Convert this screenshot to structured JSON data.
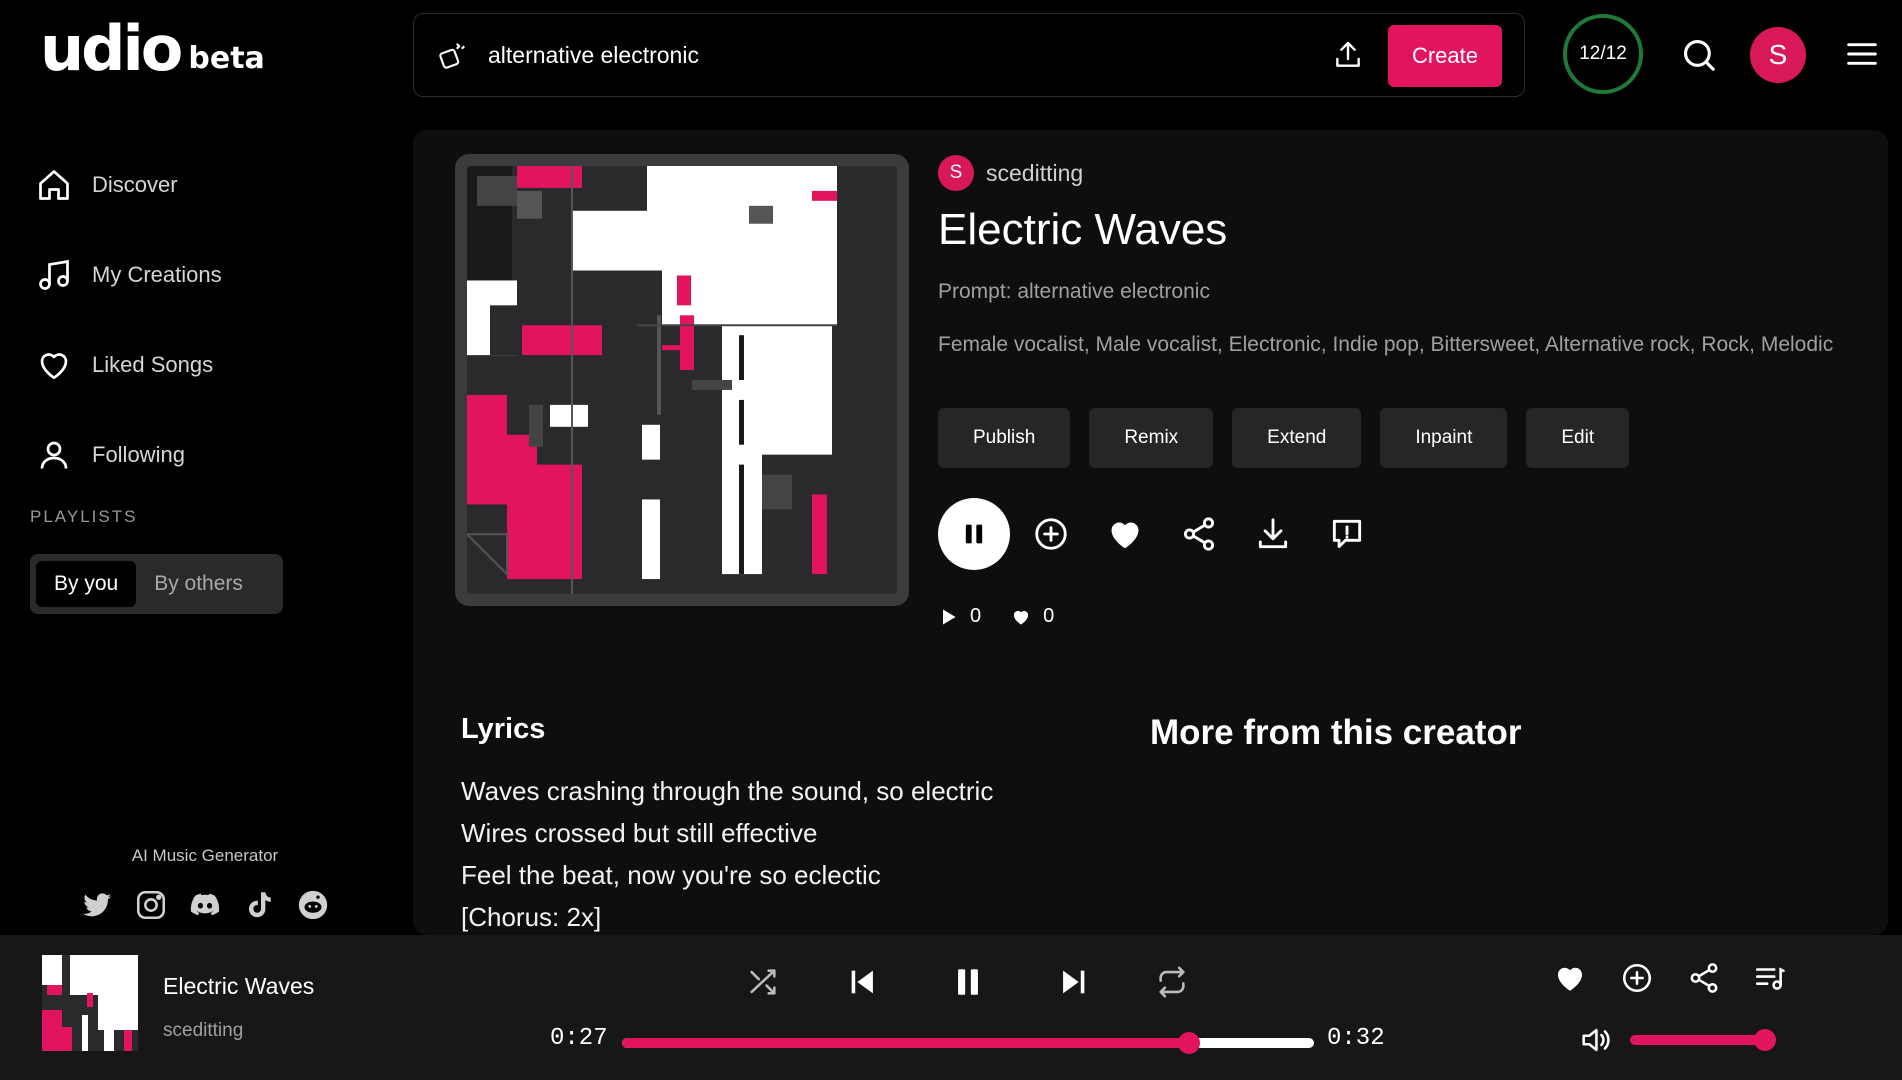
{
  "brand": {
    "word": "udio",
    "beta": "beta"
  },
  "nav": [
    {
      "label": "Discover",
      "icon": "home-icon"
    },
    {
      "label": "My Creations",
      "icon": "music-note-icon"
    },
    {
      "label": "Liked Songs",
      "icon": "heart-icon"
    },
    {
      "label": "Following",
      "icon": "person-icon"
    }
  ],
  "playlists": {
    "label": "PLAYLISTS",
    "tabs": [
      "By you",
      "By others"
    ],
    "active": "By you"
  },
  "footer": {
    "label": "AI Music Generator",
    "socials": [
      "twitter-icon",
      "instagram-icon",
      "discord-icon",
      "tiktok-icon",
      "reddit-icon"
    ]
  },
  "search": {
    "value": "alternative electronic",
    "create_label": "Create"
  },
  "credits": "12/12",
  "user": {
    "initial": "S"
  },
  "song": {
    "creator": "sceditting",
    "creator_initial": "S",
    "title": "Electric Waves",
    "prompt": "Prompt: alternative electronic",
    "tags": "Female vocalist, Male vocalist, Electronic, Indie pop, Bittersweet, Alternative rock, Rock, Melodic",
    "actions": [
      "Publish",
      "Remix",
      "Extend",
      "Inpaint",
      "Edit"
    ],
    "plays": "0",
    "likes": "0"
  },
  "lyrics": {
    "heading": "Lyrics",
    "lines": [
      "Waves crashing through the sound, so electric",
      "Wires crossed but still effective",
      "Feel the beat, now you're so eclectic",
      "[Chorus: 2x]"
    ]
  },
  "more": {
    "heading": "More from this creator"
  },
  "player": {
    "title": "Electric Waves",
    "artist": "sceditting",
    "elapsed": "0:27",
    "duration": "0:32",
    "progress": 0.82,
    "volume": 1.0
  },
  "colors": {
    "accent": "#e3145f",
    "credits_ring": "#1f7a3a",
    "panel": "#0e0e0f",
    "player_bg": "#171717"
  }
}
